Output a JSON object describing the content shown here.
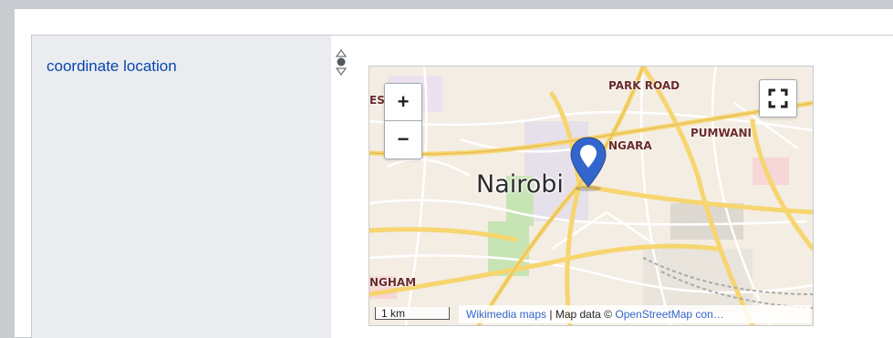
{
  "statement": {
    "property_label": "coordinate location"
  },
  "map": {
    "city_label": "Nairobi",
    "district_labels": [
      "PARK ROAD",
      "NGARA",
      "PUMWANI",
      "NGHAM",
      "ES"
    ],
    "zoom_in_label": "+",
    "zoom_out_label": "−",
    "scale_label": "1 km",
    "attribution_prefix": "Wikimedia maps",
    "attribution_separator": " | Map data © ",
    "attribution_link": "OpenStreetMap con…"
  },
  "colors": {
    "link": "#0645ad",
    "marker": "#36c",
    "road_major": "#f7d56f",
    "park": "#c7e4b5"
  },
  "icons": {
    "rank": "rank-selector-icon",
    "fullscreen": "fullscreen-icon",
    "marker": "map-marker-icon"
  }
}
